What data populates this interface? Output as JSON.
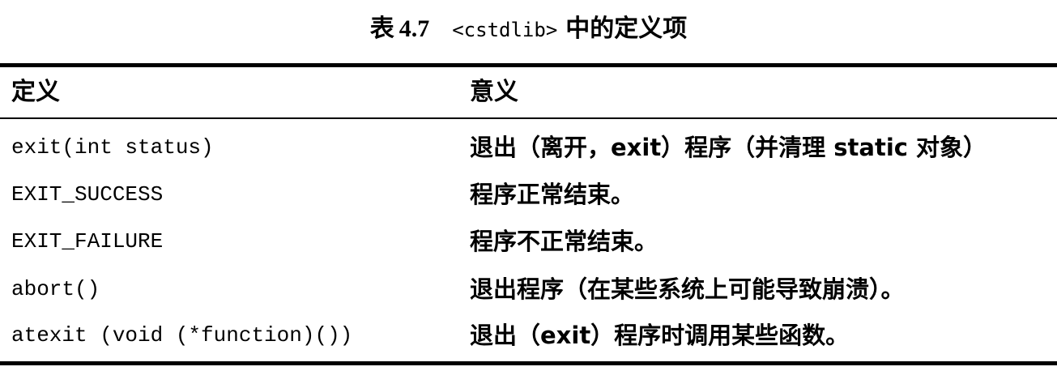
{
  "caption": {
    "label": "表",
    "number": "4.7",
    "header_name": "<cstdlib>",
    "title_suffix": "中的定义项"
  },
  "table": {
    "columns": [
      "定义",
      "意义"
    ],
    "rows": [
      {
        "definition": "exit(int status)",
        "meaning": "退出（离开，exit）程序（并清理 static 对象）"
      },
      {
        "definition": "EXIT_SUCCESS",
        "meaning": "程序正常结束。"
      },
      {
        "definition": "EXIT_FAILURE",
        "meaning": "程序不正常结束。"
      },
      {
        "definition": "abort()",
        "meaning": "退出程序（在某些系统上可能导致崩溃）。"
      },
      {
        "definition": "atexit (void (*function)())",
        "meaning": "退出（exit）程序时调用某些函数。"
      }
    ]
  }
}
